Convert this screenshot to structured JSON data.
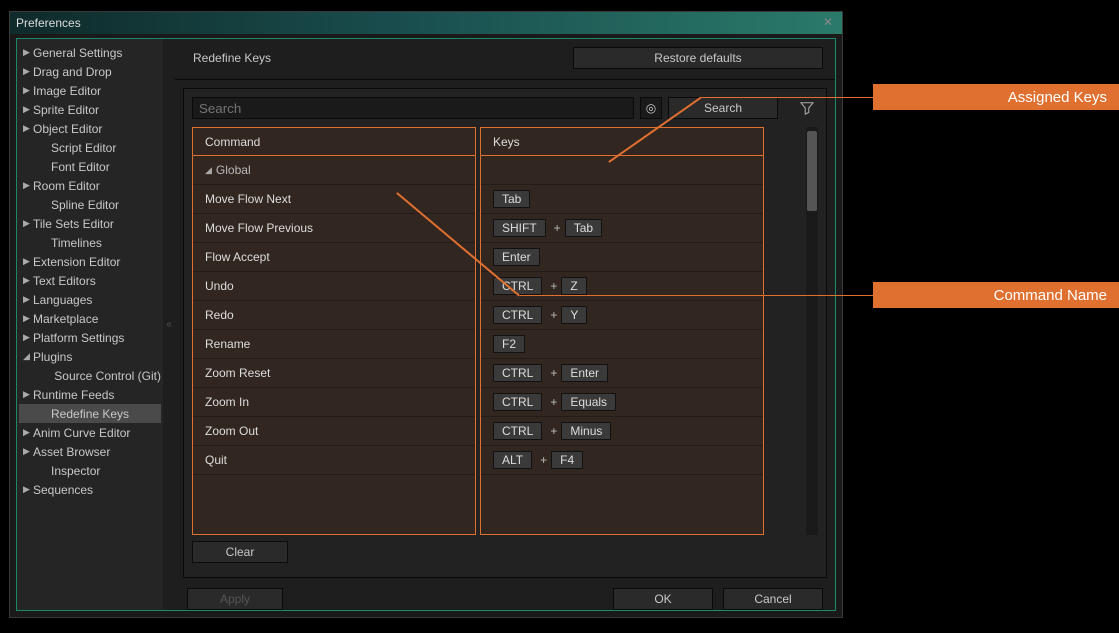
{
  "window": {
    "title": "Preferences"
  },
  "sidebar": {
    "items": [
      {
        "label": "General Settings",
        "expandable": true
      },
      {
        "label": "Drag and Drop",
        "expandable": true
      },
      {
        "label": "Image Editor",
        "expandable": true
      },
      {
        "label": "Sprite Editor",
        "expandable": true
      },
      {
        "label": "Object Editor",
        "expandable": true
      },
      {
        "label": "Script Editor",
        "expandable": false,
        "child": true
      },
      {
        "label": "Font Editor",
        "expandable": false,
        "child": true
      },
      {
        "label": "Room Editor",
        "expandable": true
      },
      {
        "label": "Spline Editor",
        "expandable": false,
        "child": true
      },
      {
        "label": "Tile Sets Editor",
        "expandable": true
      },
      {
        "label": "Timelines",
        "expandable": false,
        "child": true
      },
      {
        "label": "Extension Editor",
        "expandable": true
      },
      {
        "label": "Text Editors",
        "expandable": true
      },
      {
        "label": "Languages",
        "expandable": true
      },
      {
        "label": "Marketplace",
        "expandable": true
      },
      {
        "label": "Platform Settings",
        "expandable": true
      },
      {
        "label": "Plugins",
        "expandable": true,
        "open": true
      },
      {
        "label": "Source Control (Git)",
        "expandable": false,
        "child2": true
      },
      {
        "label": "Runtime Feeds",
        "expandable": true
      },
      {
        "label": "Redefine Keys",
        "expandable": false,
        "child": true,
        "selected": true
      },
      {
        "label": "Anim Curve Editor",
        "expandable": true
      },
      {
        "label": "Asset Browser",
        "expandable": true
      },
      {
        "label": "Inspector",
        "expandable": false,
        "child": true
      },
      {
        "label": "Sequences",
        "expandable": true
      }
    ]
  },
  "main": {
    "title": "Redefine Keys",
    "restore_label": "Restore defaults",
    "search_placeholder": "Search",
    "search_button": "Search",
    "clear_label": "Clear",
    "headers": {
      "command": "Command",
      "keys": "Keys"
    },
    "group": "Global",
    "rows": [
      {
        "cmd": "Move Flow Next",
        "keys": [
          "Tab"
        ]
      },
      {
        "cmd": "Move Flow Previous",
        "keys": [
          "SHIFT",
          "Tab"
        ]
      },
      {
        "cmd": "Flow Accept",
        "keys": [
          "Enter"
        ]
      },
      {
        "cmd": "Undo",
        "keys": [
          "CTRL",
          "Z"
        ]
      },
      {
        "cmd": "Redo",
        "keys": [
          "CTRL",
          "Y"
        ]
      },
      {
        "cmd": "Rename",
        "keys": [
          "F2"
        ]
      },
      {
        "cmd": "Zoom Reset",
        "keys": [
          "CTRL",
          "Enter"
        ]
      },
      {
        "cmd": "Zoom In",
        "keys": [
          "CTRL",
          "Equals"
        ]
      },
      {
        "cmd": "Zoom Out",
        "keys": [
          "CTRL",
          "Minus"
        ]
      },
      {
        "cmd": "Quit",
        "keys": [
          "ALT",
          "F4"
        ]
      }
    ]
  },
  "footer": {
    "apply": "Apply",
    "ok": "OK",
    "cancel": "Cancel"
  },
  "annotations": {
    "assigned_keys": "Assigned Keys",
    "command_name": "Command Name"
  }
}
